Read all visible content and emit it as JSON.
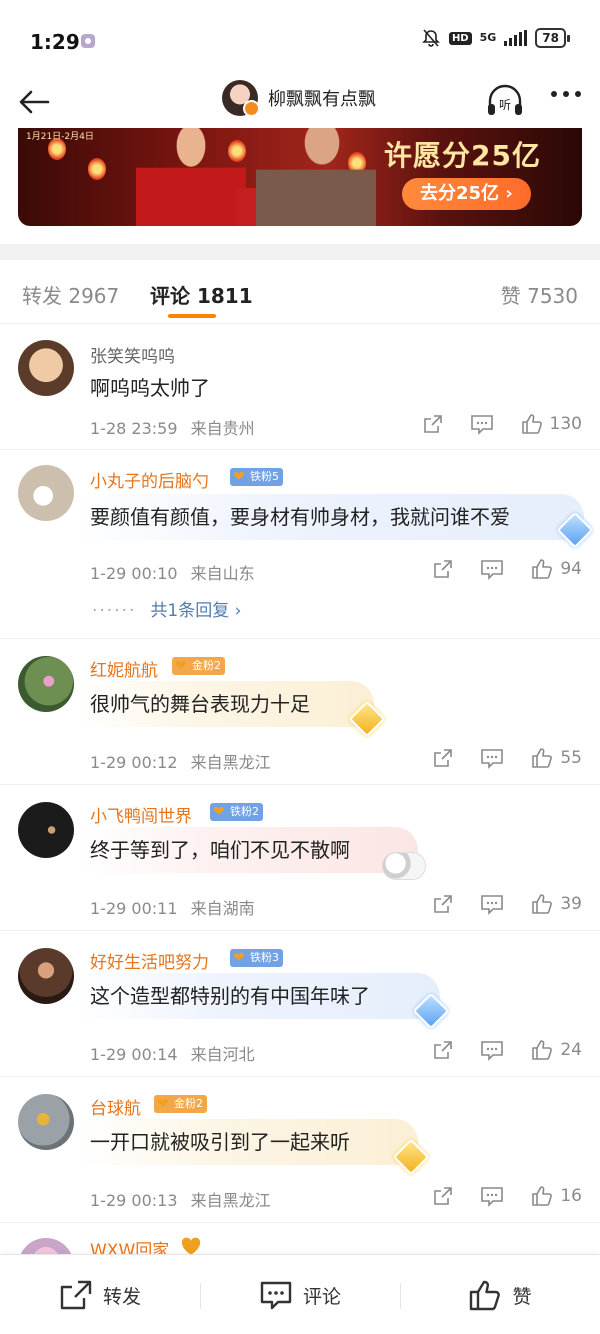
{
  "status_bar": {
    "time": "1:29",
    "hd": "HD",
    "network": "5G",
    "battery": "78"
  },
  "nav": {
    "title": "柳飘飘有点飘",
    "listen_label": "听"
  },
  "banner": {
    "date": "1月21日-2月4日",
    "headline": "许愿分25亿",
    "cta": "去分25亿 ›"
  },
  "tabs": {
    "repost": "转发 2967",
    "comment": "评论 1811",
    "like": "赞 7530"
  },
  "comments": [
    {
      "name": "张笑笑呜呜",
      "badge": "",
      "text": "啊呜呜太帅了",
      "time": "1-28 23:59",
      "location": "来自贵州",
      "likes": "130",
      "avatar_color": "#d9b89a"
    },
    {
      "name": "小丸子的后脑勺",
      "badge": "铁粉5",
      "text": "要颜值有颜值，要身材有帅身材，我就问谁不爱",
      "time": "1-29 00:10",
      "location": "来自山东",
      "likes": "94",
      "reply_text": "共1条回复 ›",
      "avatar_color": "#cdbfae"
    },
    {
      "name": "红妮航航",
      "badge": "金粉2",
      "text": "很帅气的舞台表现力十足",
      "time": "1-29 00:12",
      "location": "来自黑龙江",
      "likes": "55",
      "avatar_color": "#6e8f52"
    },
    {
      "name": "小飞鸭闯世界",
      "badge": "铁粉2",
      "text": "终于等到了，咱们不见不散啊",
      "time": "1-29 00:11",
      "location": "来自湖南",
      "likes": "39",
      "avatar_color": "#1b1b1b"
    },
    {
      "name": "好好生活吧努力",
      "badge": "铁粉3",
      "text": "这个造型都特别的有中国年味了",
      "time": "1-29 00:14",
      "location": "来自河北",
      "likes": "24",
      "avatar_color": "#5a3a2a"
    },
    {
      "name": "台球航",
      "badge": "金粉2",
      "text": "一开口就被吸引到了一起来听",
      "time": "1-29 00:13",
      "location": "来自黑龙江",
      "likes": "16",
      "avatar_color": "#9aa2a8"
    },
    {
      "name": "WXW回家",
      "avatar_color": "#c9a6c9"
    }
  ],
  "bottom_bar": {
    "repost": "转发",
    "comment": "评论",
    "like": "赞"
  },
  "colors": {
    "accent": "#ff8200",
    "vip_name": "#e8741a",
    "link": "#507daf",
    "meta": "#8a8a8a"
  }
}
